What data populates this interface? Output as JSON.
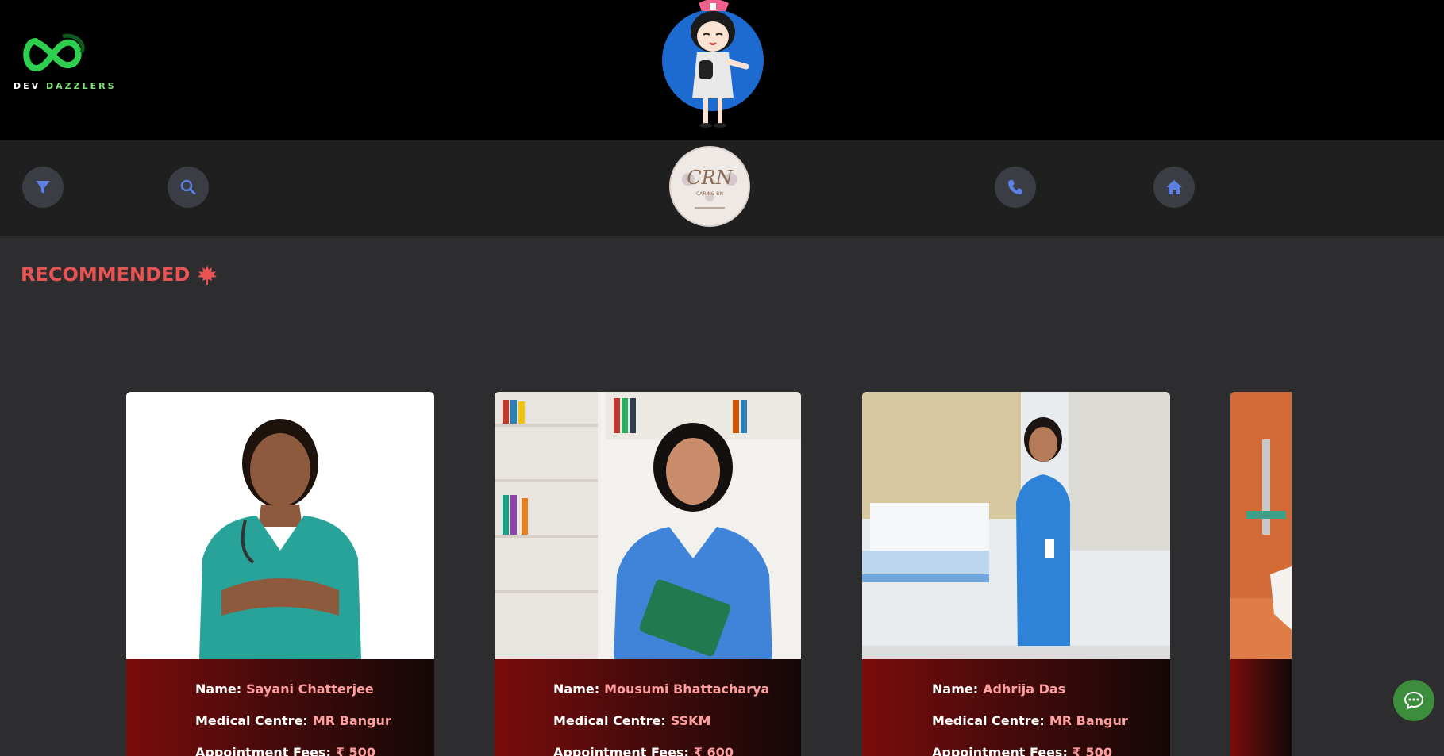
{
  "header": {
    "brand_part1": "DEV ",
    "brand_part2": "DAZZLERS",
    "brand_green": "#7ee07a",
    "mascot_icon": "nurse-mascot"
  },
  "nav": {
    "filter_icon": "filter-icon",
    "search_icon": "search-icon",
    "logo_text": "CRN",
    "logo_sub": "CARING RN",
    "phone_icon": "phone-icon",
    "home_icon": "home-icon",
    "icon_color": "#5d7fe0"
  },
  "section": {
    "title": "RECOMMENDED",
    "title_color": "#e85454",
    "title_icon": "maple-leaf-icon"
  },
  "labels": {
    "name": "Name:",
    "centre": "Medical Centre:",
    "fees": "Appointment Fees:"
  },
  "cards": [
    {
      "name": "Sayani Chatterjee",
      "centre": "MR Bangur",
      "fees": "₹ 500"
    },
    {
      "name": "Mousumi Bhattacharya",
      "centre": "SSKM",
      "fees": "₹ 600"
    },
    {
      "name": "Adhrija Das",
      "centre": "MR Bangur",
      "fees": "₹ 500"
    }
  ],
  "chat": {
    "icon": "chat-icon",
    "color": "#3c8d3c"
  }
}
